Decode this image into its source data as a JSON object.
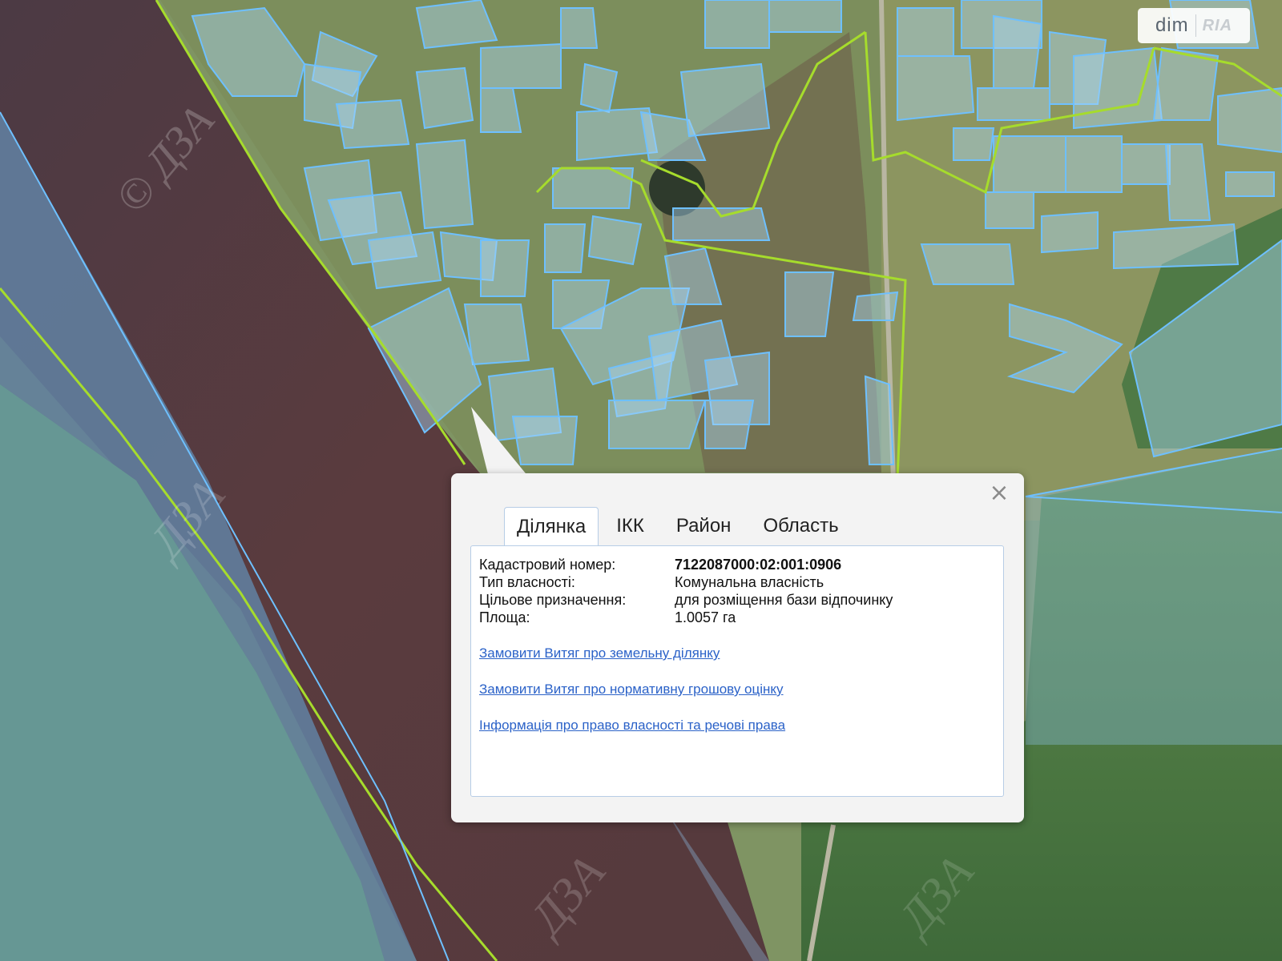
{
  "logo": {
    "brand": "dim",
    "sub": "RIA"
  },
  "map": {
    "watermarks": [
      "© ДЗА",
      "ДЗА",
      "ДЗА",
      "ДЗА"
    ]
  },
  "popup": {
    "tabs": [
      {
        "label": "Ділянка",
        "active": true
      },
      {
        "label": "ІКК",
        "active": false
      },
      {
        "label": "Район",
        "active": false
      },
      {
        "label": "Область",
        "active": false
      }
    ],
    "close_icon": "close-icon",
    "attributes": [
      {
        "label": "Кадастровий номер:",
        "value": "7122087000:02:001:0906"
      },
      {
        "label": "Тип власності:",
        "value": "Комунальна власність"
      },
      {
        "label": "Цільове призначення:",
        "value": "для розміщення бази відпочинку"
      },
      {
        "label": "Площа:",
        "value": "1.0057 га"
      }
    ],
    "links": [
      "Замовити Витяг про земельну ділянку",
      "Замовити Витяг про нормативну грошову оцінку",
      "Інформація про право власності та речові права"
    ]
  },
  "colors": {
    "parcel_stroke": "#6ec0ff",
    "boundary": "#a6dc2c",
    "link": "#2b62c8",
    "river": "#563b3f"
  }
}
